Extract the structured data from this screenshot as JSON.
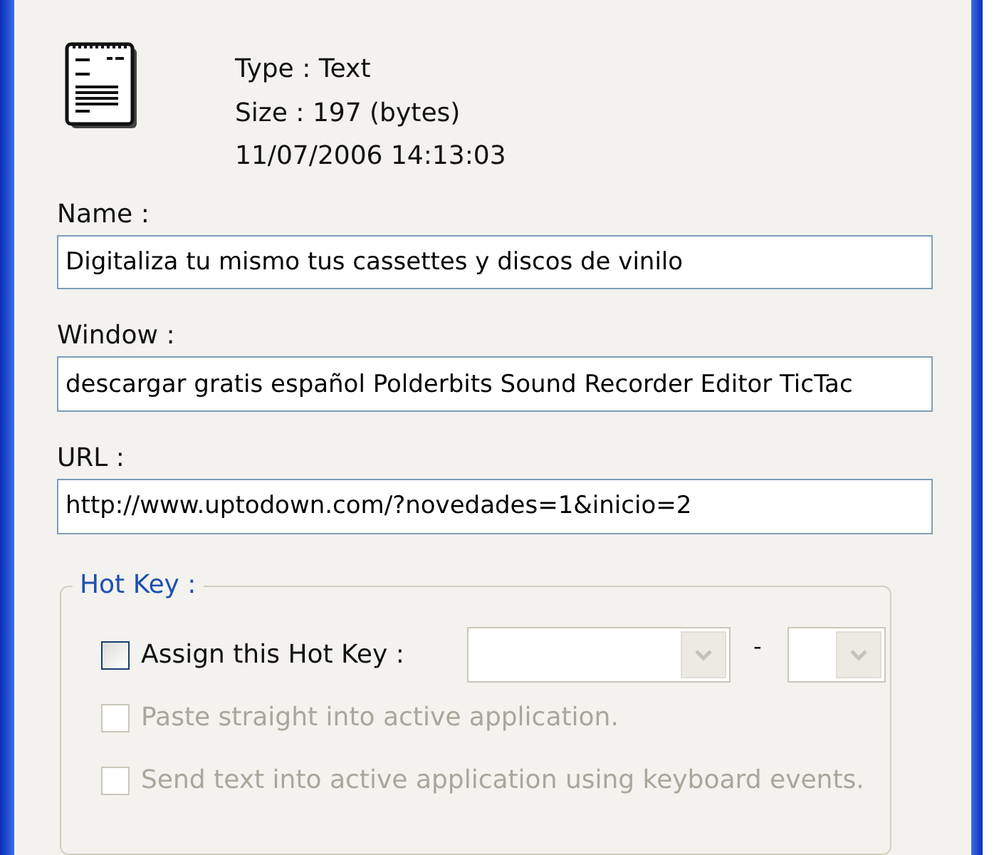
{
  "info": {
    "type": "Type : Text",
    "size": "Size : 197 (bytes)",
    "date": "11/07/2006 14:13:03"
  },
  "fields": [
    {
      "label": "Name :",
      "value": "Digitaliza tu mismo tus cassettes y discos de vinilo"
    },
    {
      "label": "Window :",
      "value": "descargar gratis español Polderbits Sound Recorder Editor TicTac"
    },
    {
      "label": "URL :",
      "value": "http://www.uptodown.com/?novedades=1&inicio=2"
    }
  ],
  "hotkey": {
    "title": "Hot Key :",
    "separator": "-",
    "options": [
      {
        "label": "Assign this Hot Key :",
        "checked": false,
        "disabled": false
      },
      {
        "label": "Paste straight into active application.",
        "checked": false,
        "disabled": true
      },
      {
        "label": "Send text into active application using keyboard events.",
        "checked": false,
        "disabled": true
      }
    ]
  }
}
